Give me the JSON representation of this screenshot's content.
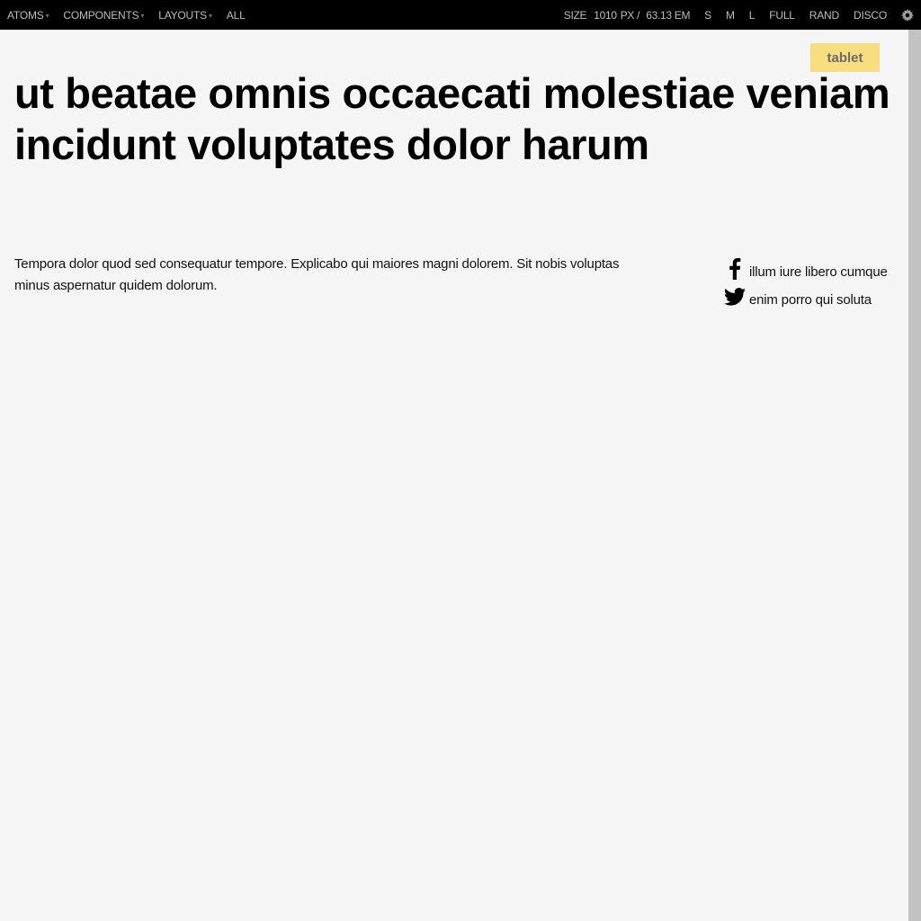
{
  "toolbar": {
    "nav": [
      {
        "label": "ATOMS",
        "dropdown": true
      },
      {
        "label": "COMPONENTS",
        "dropdown": true
      },
      {
        "label": "LAYOUTS",
        "dropdown": true
      },
      {
        "label": "ALL",
        "dropdown": false
      }
    ],
    "size_label": "SIZE",
    "size_px": "1010",
    "size_px_unit": "PX /",
    "size_em": "63.13",
    "size_em_unit": "EM",
    "sizes": [
      "S",
      "M",
      "L",
      "FULL",
      "RAND",
      "DISCO"
    ],
    "caret": "▾"
  },
  "badge": "tablet",
  "headline": "ut beatae omnis occaecati molestiae veniam incidunt voluptates dolor harum",
  "summary": "Tempora dolor quod sed consequatur tempore. Explicabo qui maiores magni dolorem. Sit nobis voluptas minus aspernatur quidem dolorum.",
  "social": [
    {
      "icon": "facebook-icon",
      "label": "illum iure libero cumque"
    },
    {
      "icon": "twitter-icon",
      "label": "enim porro qui soluta"
    }
  ],
  "colors": {
    "toolbar_bg": "#000000",
    "toolbar_text": "#bdbdbd",
    "page_bg": "#f5f5f5",
    "badge_bg": "#f9de7f",
    "badge_text": "#6b6b6b",
    "handle": "#c2c2c2"
  }
}
